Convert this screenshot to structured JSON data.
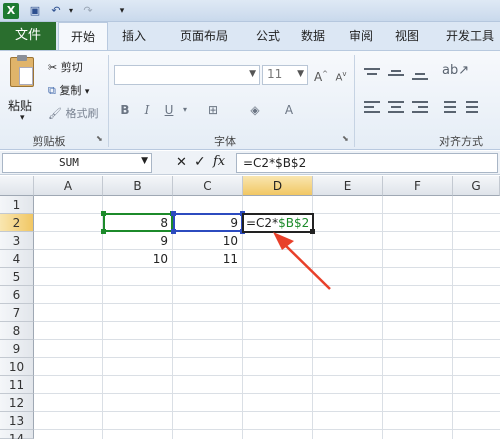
{
  "ribbon_tabs": [
    "文件",
    "开始",
    "插入",
    "页面布局",
    "公式",
    "数据",
    "审阅",
    "视图",
    "开发工具"
  ],
  "clipboard": {
    "paste": "粘贴",
    "cut": "剪切",
    "copy": "复制",
    "format_painter": "格式刷",
    "group_label": "剪贴板"
  },
  "font": {
    "size": "11",
    "group_label": "字体",
    "bold": "B",
    "italic": "I",
    "underline": "U"
  },
  "alignment": {
    "group_label": "对齐方式"
  },
  "formula_bar": {
    "name_box": "SUM",
    "cancel": "✕",
    "enter": "✓",
    "fx": "fx",
    "formula": "=C2*$B$2"
  },
  "columns": [
    "A",
    "B",
    "C",
    "D",
    "E",
    "F",
    "G"
  ],
  "rows": [
    "1",
    "2",
    "3",
    "4",
    "5",
    "6",
    "7",
    "8",
    "9",
    "10",
    "11",
    "12",
    "13",
    "14"
  ],
  "cells": {
    "B2": "8",
    "C2": "9",
    "B3": "9",
    "C3": "10",
    "B4": "10",
    "C4": "11",
    "D2_part1": "=C2*",
    "D2_part2": "$B$2"
  },
  "colors": {
    "file_tab": "#2a6e2e",
    "active_header": "#f1c764",
    "ref_green": "#1c8a2a",
    "ref_blue": "#2c4bbf",
    "arrow": "#e8402a"
  }
}
